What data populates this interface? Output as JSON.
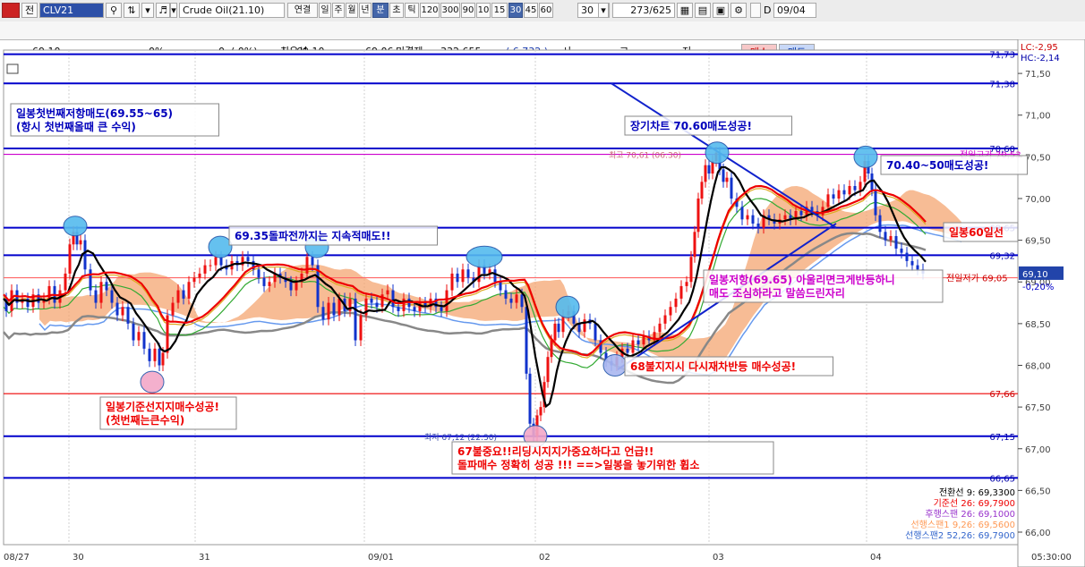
{
  "toolbar": {
    "market_tab": "전",
    "symbol_code": "CLV21",
    "symbol_name": "Crude Oil(21.10)",
    "buttons": [
      "연결",
      "일",
      "주",
      "월",
      "년",
      "분",
      "초",
      "틱",
      "120",
      "300",
      "90",
      "10",
      "15",
      "30",
      "45",
      "60"
    ],
    "selected": [
      "분",
      "30"
    ],
    "interval_value": "30",
    "count": "273",
    "count_total": "/625",
    "date_checkbox": "D",
    "date_value": "09/04"
  },
  "infobar": {
    "price": "69.10",
    "change_pct": "0%",
    "volume_open": "0",
    "volume_paren": "(      0%)",
    "best_bid_label": "최우선",
    "best_bid": "69.10",
    "best_ask": "69.06",
    "unsettled_label": "미결제",
    "unsettled": "332,655",
    "unsettled_change": "( 6,732 )",
    "open_label": "시",
    "high_label": "고",
    "low_label": "저",
    "sell_button": "매수",
    "buy_button": "매도"
  },
  "chart_data": {
    "type": "candlestick",
    "symbol": "Crude Oil(21.10)",
    "interval": "30분",
    "ylim": [
      65.85,
      71.78
    ],
    "y_ticks": [
      66.0,
      66.5,
      67.0,
      67.5,
      68.0,
      68.5,
      69.0,
      69.5,
      70.0,
      70.5,
      71.0,
      71.5
    ],
    "y_tick_labels": [
      "66,00",
      "66,50",
      "67,00",
      "67,50",
      "68,00",
      "68,50",
      "69,00",
      "69,50",
      "70,00",
      "70,50",
      "71,00",
      "71,50"
    ],
    "x_tick_labels": [
      "08/27",
      "30",
      "31",
      "09/01",
      "02",
      "03",
      "04",
      "05:30:00"
    ],
    "lc": "LC:-2,95",
    "hc": "HC:-2,14",
    "current_price_label": "69,10",
    "current_change_label": "-0,20%",
    "prev_low_label": "전일저가 69,05",
    "high_marker_label": "최고 70,61 (06:30)",
    "low_marker_label": "최저 67,12 (22:30)",
    "prev_high_label": "전일고가 70,53",
    "horizontal_levels": [
      {
        "value": 71.73,
        "label": "71,73",
        "color": "#0000cc"
      },
      {
        "value": 71.38,
        "label": "71,38",
        "color": "#0000cc"
      },
      {
        "value": 70.6,
        "label": "70,60",
        "color": "#0000cc"
      },
      {
        "value": 70.53,
        "label": "",
        "color": "#cc00cc"
      },
      {
        "value": 69.65,
        "label": "69,65",
        "color": "#0000cc"
      },
      {
        "value": 69.32,
        "label": "69,32",
        "color": "#0000cc"
      },
      {
        "value": 69.05,
        "label": "",
        "color": "#ff6666"
      },
      {
        "value": 67.66,
        "label": "67,66",
        "color": "#ee0000"
      },
      {
        "value": 67.15,
        "label": "67,15",
        "color": "#0000cc"
      },
      {
        "value": 66.65,
        "label": "66,65",
        "color": "#0000cc"
      }
    ],
    "indicators": [
      {
        "label": "전환선 9: 69,3300",
        "color": "#000000"
      },
      {
        "label": "기준선 26: 69,7900",
        "color": "#ee0000"
      },
      {
        "label": "후행스팬 26: 69,1000",
        "color": "#9933cc"
      },
      {
        "label": "선행스팬1 9,26: 69,5600",
        "color": "#ff9955"
      },
      {
        "label": "선행스팬2 52,26: 69,7900",
        "color": "#3366cc"
      }
    ],
    "annotations": [
      {
        "lines": [
          "일봉첫번째저항매도(69.55~65)",
          "(항시 첫번째올때 큰 수익)"
        ],
        "color": "#0000bb"
      },
      {
        "lines": [
          "69.35돌파전까지는 지속적매도!!"
        ],
        "color": "#0000bb"
      },
      {
        "lines": [
          "장기차트 70.60매도성공!"
        ],
        "color": "#0000bb"
      },
      {
        "lines": [
          "70.40~50매도성공!"
        ],
        "color": "#0000bb"
      },
      {
        "lines": [
          "일봉60일선"
        ],
        "color": "#ee0000"
      },
      {
        "lines": [
          "일봉저항(69.65) 아울리면크게반등하니",
          "매도 조심하라고 말씀드린자리"
        ],
        "color": "#cc00cc"
      },
      {
        "lines": [
          "68불지지시 다시재차반등 매수성공!"
        ],
        "color": "#ee0000"
      },
      {
        "lines": [
          "일봉기준선지지매수성공!",
          "(첫번째는큰수익)"
        ],
        "color": "#ee0000"
      },
      {
        "lines": [
          "67불중요!!리딩시지지가중요하다고 언급!!",
          "돌파매수 정확히 성공 !!! ==>일봉을 놓기위한 휩소"
        ],
        "color": "#ee0000"
      }
    ],
    "price_path": [
      [
        0,
        68.8
      ],
      [
        6,
        68.65
      ],
      [
        12,
        68.9
      ],
      [
        18,
        68.75
      ],
      [
        24,
        68.8
      ],
      [
        30,
        68.7
      ],
      [
        36,
        68.85
      ],
      [
        42,
        68.75
      ],
      [
        48,
        68.8
      ],
      [
        54,
        68.95
      ],
      [
        60,
        68.75
      ],
      [
        66,
        68.9
      ],
      [
        72,
        69.1
      ],
      [
        76,
        69.45
      ],
      [
        80,
        69.6
      ],
      [
        84,
        69.45
      ],
      [
        88,
        69.5
      ],
      [
        94,
        69.15
      ],
      [
        100,
        68.9
      ],
      [
        106,
        68.75
      ],
      [
        112,
        69.0
      ],
      [
        118,
        68.9
      ],
      [
        124,
        68.75
      ],
      [
        130,
        68.6
      ],
      [
        136,
        68.7
      ],
      [
        142,
        68.5
      ],
      [
        148,
        68.3
      ],
      [
        154,
        68.4
      ],
      [
        160,
        68.2
      ],
      [
        166,
        68.05
      ],
      [
        172,
        68.2
      ],
      [
        176,
        68.0
      ],
      [
        180,
        68.15
      ],
      [
        186,
        68.6
      ],
      [
        192,
        68.75
      ],
      [
        198,
        68.9
      ],
      [
        204,
        68.8
      ],
      [
        210,
        69.0
      ],
      [
        216,
        69.05
      ],
      [
        222,
        69.1
      ],
      [
        228,
        69.2
      ],
      [
        234,
        69.2
      ],
      [
        240,
        69.3
      ],
      [
        246,
        69.2
      ],
      [
        252,
        69.15
      ],
      [
        258,
        69.25
      ],
      [
        264,
        69.2
      ],
      [
        270,
        69.3
      ],
      [
        276,
        69.25
      ],
      [
        282,
        69.15
      ],
      [
        288,
        69.05
      ],
      [
        294,
        68.95
      ],
      [
        300,
        69.0
      ],
      [
        306,
        69.1
      ],
      [
        312,
        69.05
      ],
      [
        318,
        69.0
      ],
      [
        324,
        68.9
      ],
      [
        330,
        69.0
      ],
      [
        336,
        69.1
      ],
      [
        342,
        69.3
      ],
      [
        348,
        69.2
      ],
      [
        354,
        68.7
      ],
      [
        360,
        68.55
      ],
      [
        366,
        68.75
      ],
      [
        372,
        68.6
      ],
      [
        378,
        68.8
      ],
      [
        384,
        68.65
      ],
      [
        390,
        68.8
      ],
      [
        396,
        68.3
      ],
      [
        402,
        68.6
      ],
      [
        408,
        68.8
      ],
      [
        414,
        68.75
      ],
      [
        420,
        68.7
      ],
      [
        426,
        68.85
      ],
      [
        432,
        68.9
      ],
      [
        438,
        68.7
      ],
      [
        444,
        68.65
      ],
      [
        450,
        68.8
      ],
      [
        456,
        68.7
      ],
      [
        462,
        68.65
      ],
      [
        468,
        68.75
      ],
      [
        474,
        68.7
      ],
      [
        480,
        68.8
      ],
      [
        486,
        68.7
      ],
      [
        492,
        68.65
      ],
      [
        498,
        68.9
      ],
      [
        504,
        69.1
      ],
      [
        510,
        69.0
      ],
      [
        516,
        69.15
      ],
      [
        522,
        69.05
      ],
      [
        528,
        69.0
      ],
      [
        534,
        69.2
      ],
      [
        540,
        69.1
      ],
      [
        546,
        69.15
      ],
      [
        552,
        69.0
      ],
      [
        558,
        68.9
      ],
      [
        564,
        68.8
      ],
      [
        570,
        68.75
      ],
      [
        576,
        68.85
      ],
      [
        582,
        68.7
      ],
      [
        586,
        67.9
      ],
      [
        590,
        67.3
      ],
      [
        594,
        67.15
      ],
      [
        598,
        67.4
      ],
      [
        602,
        67.5
      ],
      [
        606,
        67.8
      ],
      [
        610,
        68.1
      ],
      [
        614,
        68.3
      ],
      [
        618,
        68.5
      ],
      [
        622,
        68.4
      ],
      [
        628,
        68.6
      ],
      [
        634,
        68.65
      ],
      [
        640,
        68.5
      ],
      [
        646,
        68.4
      ],
      [
        652,
        68.55
      ],
      [
        658,
        68.5
      ],
      [
        664,
        68.3
      ],
      [
        670,
        68.15
      ],
      [
        676,
        68.05
      ],
      [
        682,
        68.0
      ],
      [
        688,
        68.1
      ],
      [
        694,
        68.2
      ],
      [
        700,
        68.15
      ],
      [
        706,
        68.3
      ],
      [
        712,
        68.25
      ],
      [
        718,
        68.35
      ],
      [
        724,
        68.3
      ],
      [
        730,
        68.4
      ],
      [
        736,
        68.5
      ],
      [
        742,
        68.6
      ],
      [
        748,
        68.7
      ],
      [
        754,
        68.8
      ],
      [
        760,
        68.95
      ],
      [
        766,
        69.0
      ],
      [
        770,
        69.3
      ],
      [
        774,
        69.6
      ],
      [
        778,
        70.0
      ],
      [
        782,
        70.2
      ],
      [
        786,
        70.4
      ],
      [
        790,
        70.3
      ],
      [
        794,
        70.45
      ],
      [
        798,
        70.55
      ],
      [
        802,
        70.35
      ],
      [
        806,
        70.2
      ],
      [
        810,
        70.25
      ],
      [
        816,
        70.0
      ],
      [
        822,
        69.9
      ],
      [
        828,
        69.75
      ],
      [
        834,
        69.8
      ],
      [
        840,
        69.7
      ],
      [
        846,
        69.65
      ],
      [
        852,
        69.8
      ],
      [
        858,
        69.75
      ],
      [
        864,
        69.7
      ],
      [
        870,
        69.75
      ],
      [
        876,
        69.8
      ],
      [
        882,
        69.75
      ],
      [
        888,
        69.85
      ],
      [
        894,
        69.8
      ],
      [
        900,
        69.9
      ],
      [
        906,
        69.85
      ],
      [
        912,
        69.8
      ],
      [
        918,
        69.9
      ],
      [
        924,
        70.05
      ],
      [
        930,
        70.0
      ],
      [
        936,
        70.1
      ],
      [
        942,
        70.05
      ],
      [
        948,
        70.15
      ],
      [
        954,
        70.1
      ],
      [
        960,
        70.2
      ],
      [
        964,
        70.45
      ],
      [
        968,
        70.3
      ],
      [
        972,
        70.1
      ],
      [
        976,
        69.8
      ],
      [
        982,
        69.6
      ],
      [
        988,
        69.5
      ],
      [
        994,
        69.55
      ],
      [
        1000,
        69.4
      ],
      [
        1006,
        69.35
      ],
      [
        1012,
        69.25
      ],
      [
        1018,
        69.2
      ],
      [
        1024,
        69.15
      ],
      [
        1030,
        69.1
      ]
    ]
  }
}
